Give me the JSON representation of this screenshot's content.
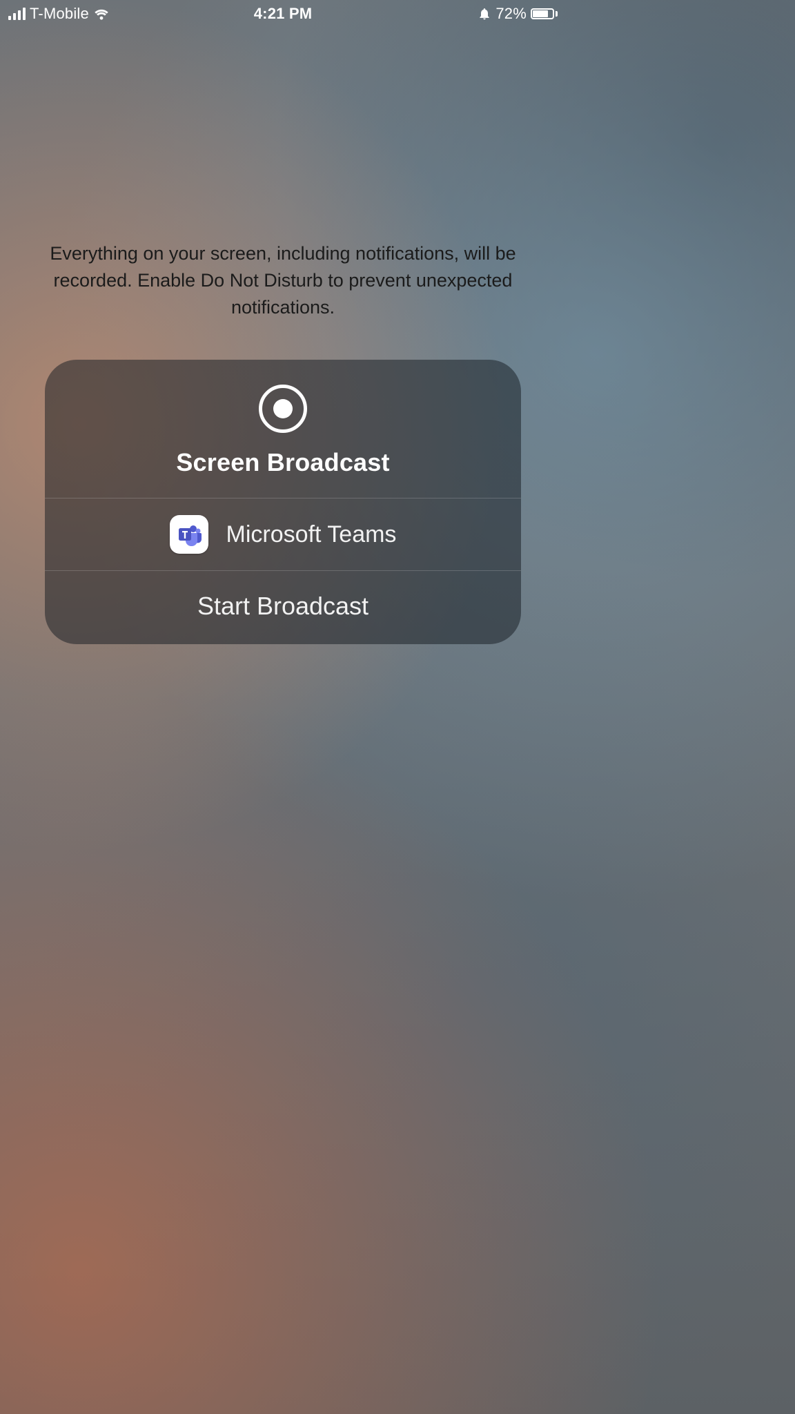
{
  "status_bar": {
    "carrier": "T-Mobile",
    "time": "4:21 PM",
    "battery_percent": "72%"
  },
  "instruction_text": "Everything on your screen, including notifications, will be recorded. Enable Do Not Disturb to prevent unexpected notifications.",
  "card": {
    "title": "Screen Broadcast",
    "app_name": "Microsoft Teams",
    "start_label": "Start Broadcast"
  }
}
